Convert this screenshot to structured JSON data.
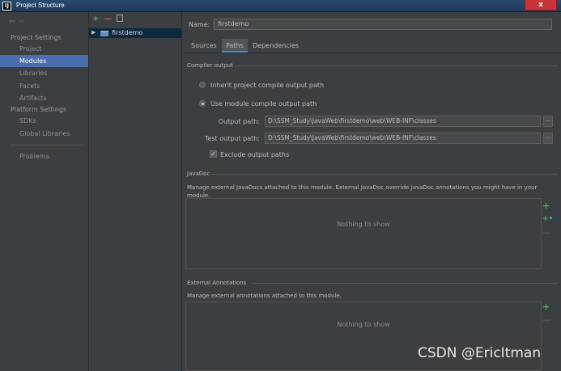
{
  "window": {
    "app_icon_letter": "IJ",
    "title": "Project Structure",
    "close_glyph": "x"
  },
  "nav": {
    "back_icon": "◆",
    "forward_icon": "◆",
    "project_settings_header": "Project Settings",
    "project_settings_items": [
      "Project",
      "Modules",
      "Libraries",
      "Facets",
      "Artifacts"
    ],
    "platform_settings_header": "Platform Settings",
    "platform_settings_items": [
      "SDKs",
      "Global Libraries"
    ],
    "other_items": [
      "Problems"
    ],
    "selected": "Modules"
  },
  "module_tree": {
    "toolbar": {
      "add": "+",
      "remove": "—"
    },
    "items": [
      {
        "label": "firstdemo",
        "expanded": false
      }
    ]
  },
  "module": {
    "name_label": "Name:",
    "name_value": "firstdemo",
    "tabs": [
      "Sources",
      "Paths",
      "Dependencies"
    ],
    "active_tab": "Paths",
    "compiler_output": {
      "title": "Compiler output",
      "inherit_label": "Inherit project compile output path",
      "use_module_label": "Use module compile output path",
      "selected_option": "Use module compile output path",
      "output_path_label": "Output path:",
      "output_path_value": "D:\\SSM_Study\\JavaWeb\\firstdemo\\web\\WEB-INF\\classes",
      "test_output_path_label": "Test output path:",
      "test_output_path_value": "D:\\SSM_Study\\JavaWeb\\firstdemo\\web\\WEB-INF\\classes",
      "browse_label": "...",
      "exclude_label": "Exclude output paths",
      "exclude_checked": true
    },
    "javadoc": {
      "title": "JavaDoc",
      "description": "Manage external JavaDocs attached to this module. External JavaDoc override JavaDoc annotations you might have in your module.",
      "empty_text": "Nothing to show"
    },
    "external_annotations": {
      "title": "External Annotations",
      "description": "Manage external annotations attached to this module.",
      "empty_text": "Nothing to show"
    }
  },
  "watermark": "CSDN @EricItman",
  "colors": {
    "background": "#3c3f41",
    "selection": "#4b6eaf",
    "tree_selection": "#0d293e",
    "add": "#59a869",
    "remove": "#c75450",
    "close": "#c7353b"
  }
}
